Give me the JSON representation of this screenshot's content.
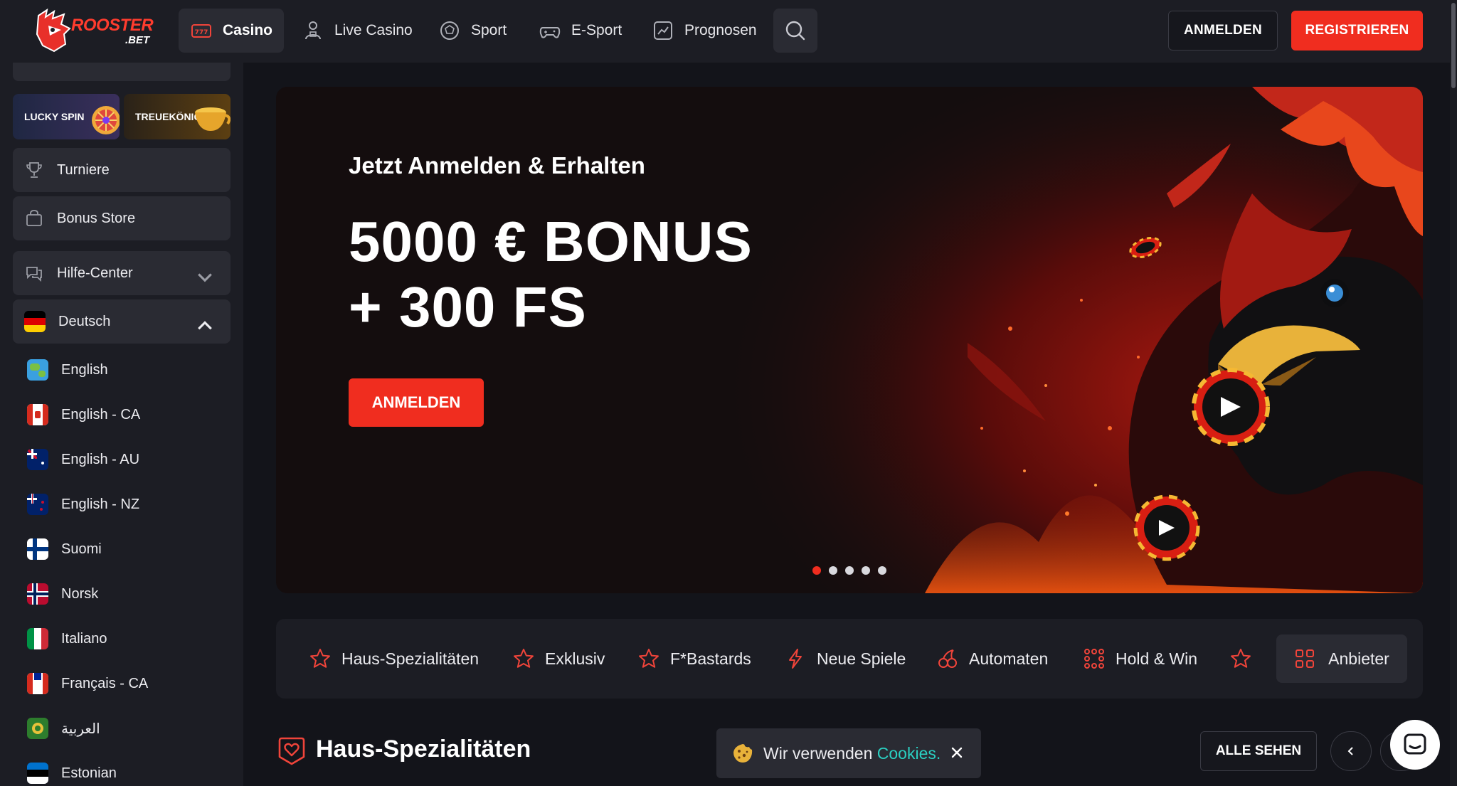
{
  "brand": {
    "name": "ROOSTER",
    "suffix": ".BET",
    "accent": "#f02d1f",
    "link_color": "#2ad0c2"
  },
  "nav": {
    "items": [
      {
        "label": "Casino",
        "icon": "slot-777-icon",
        "active": true
      },
      {
        "label": "Live Casino",
        "icon": "dealer-icon"
      },
      {
        "label": "Sport",
        "icon": "soccer-ball-icon"
      },
      {
        "label": "E-Sport",
        "icon": "gamepad-icon"
      },
      {
        "label": "Prognosen",
        "icon": "chart-up-icon"
      }
    ],
    "search_icon": "search-icon",
    "login_label": "ANMELDEN",
    "register_label": "REGISTRIEREN"
  },
  "sidebar": {
    "promos": [
      {
        "label": "LUCKY SPIN",
        "icon": "wheel-icon"
      },
      {
        "label": "TREUEKÖNIG",
        "icon": "cup-icon"
      }
    ],
    "items": [
      {
        "label": "Turniere",
        "icon": "trophy-icon"
      },
      {
        "label": "Bonus Store",
        "icon": "bag-icon"
      },
      {
        "label": "Hilfe-Center",
        "icon": "chat-help-icon"
      }
    ],
    "language": {
      "current": "Deutsch",
      "options": [
        "English",
        "English - CA",
        "English - AU",
        "English - NZ",
        "Suomi",
        "Norsk",
        "Italiano",
        "Français - CA",
        "العربية",
        "Estonian"
      ]
    }
  },
  "hero": {
    "subtitle": "Jetzt Anmelden & Erhalten",
    "title_line1": "5000 € BONUS",
    "title_line2": "+ 300 FS",
    "cta": "ANMELDEN",
    "slides": 5,
    "active_slide": 1
  },
  "categories": [
    {
      "label": "Haus-Spezialitäten",
      "icon": "star-icon"
    },
    {
      "label": "Exklusiv",
      "icon": "star-icon"
    },
    {
      "label": "F*Bastards",
      "icon": "star-icon"
    },
    {
      "label": "Neue Spiele",
      "icon": "lightning-icon"
    },
    {
      "label": "Automaten",
      "icon": "cherries-icon"
    },
    {
      "label": "Hold & Win",
      "icon": "dots-grid-icon"
    },
    {
      "label": "",
      "icon": "star-icon"
    },
    {
      "label": "Anbieter",
      "icon": "grid-icon"
    }
  ],
  "section": {
    "title": "Haus-Spezialitäten",
    "see_all": "ALLE SEHEN"
  },
  "cookie": {
    "text": "Wir verwenden",
    "link": "Cookies."
  }
}
